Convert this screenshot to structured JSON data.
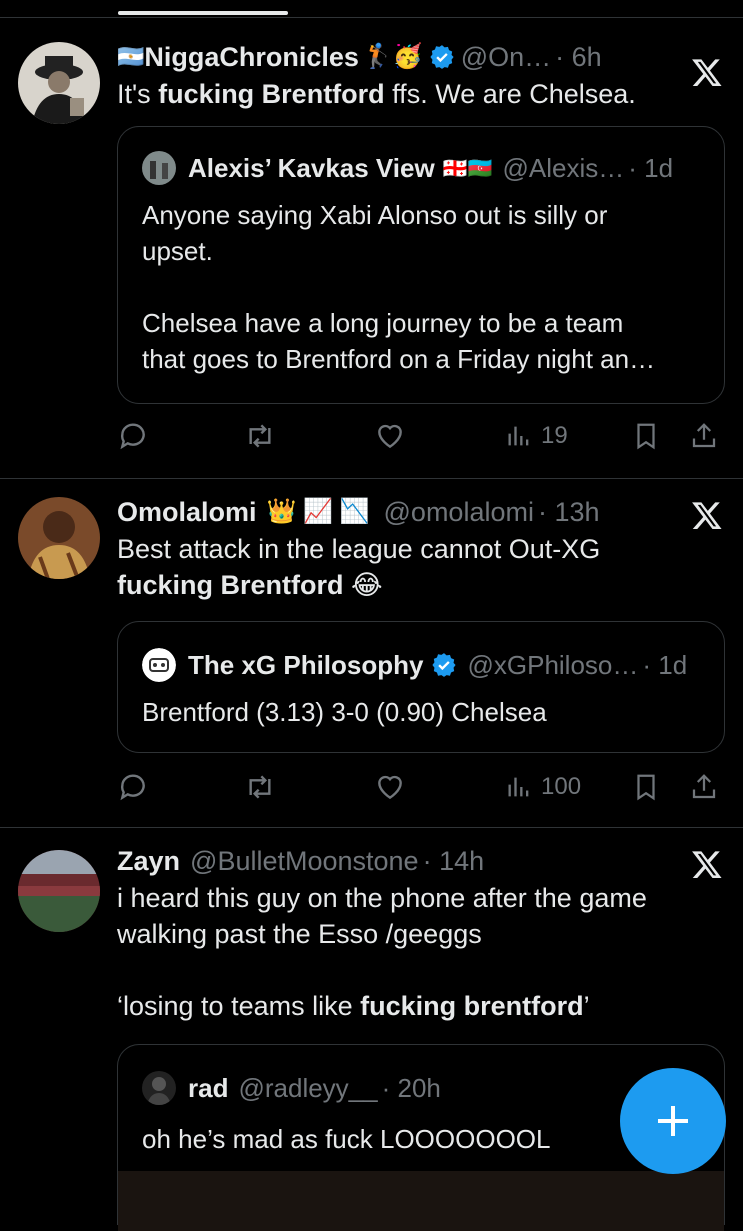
{
  "posts": [
    {
      "name": "NiggaChronicles",
      "flag": "🇦🇷",
      "emojis": "🏌️🥳",
      "handle": "@On…",
      "time": "· 6h",
      "text_before": "It's ",
      "text_bold": "fucking Brentford",
      "text_after": " ffs. We are Chelsea.",
      "quote": {
        "name": "Alexis’ Kavkas View",
        "flags": "🇬🇪🇦🇿",
        "handle": "@Alexis…",
        "time": "· 1d",
        "text": "Anyone saying Xabi Alonso out is silly or\nupset.\n\nChelsea have a long journey to be a team\nthat goes to Brentford on a Friday night an…"
      },
      "views": "19"
    },
    {
      "name": "Omolalomi",
      "emojis": "👑 📈 📉",
      "handle": "@omolalomi",
      "time": "· 13h",
      "text_before": "Best attack in the league cannot Out-XG\n",
      "text_bold": "fucking Brentford",
      "text_after": " 😂",
      "quote": {
        "name": "The xG Philosophy",
        "handle": "@xGPhiloso…",
        "time": "· 1d",
        "text": "Brentford (3.13) 3-0 (0.90) Chelsea"
      },
      "views": "100"
    },
    {
      "name": "Zayn",
      "handle": "@BulletMoonstone",
      "time": "· 14h",
      "text_before": "i heard this guy on the phone after the game\nwalking past the Esso /geeggs\n\n‘losing to teams like ",
      "text_bold": "fucking brentford",
      "text_after": "’",
      "quote": {
        "name": "rad",
        "handle": "@radleyy__",
        "time": "· 20h",
        "text": "oh he’s mad as fuck LOOOOOOOL"
      }
    }
  ],
  "icons": {
    "x_logo": "x-logo-icon",
    "reply": "reply-icon",
    "repost": "repost-icon",
    "like": "heart-icon",
    "views": "views-icon",
    "bookmark": "bookmark-icon",
    "share": "share-icon",
    "compose": "plus-icon"
  },
  "colors": {
    "background": "#000000",
    "text": "#e7e9ea",
    "muted": "#71767b",
    "border": "#2f3336",
    "accent": "#1d9bf0"
  }
}
